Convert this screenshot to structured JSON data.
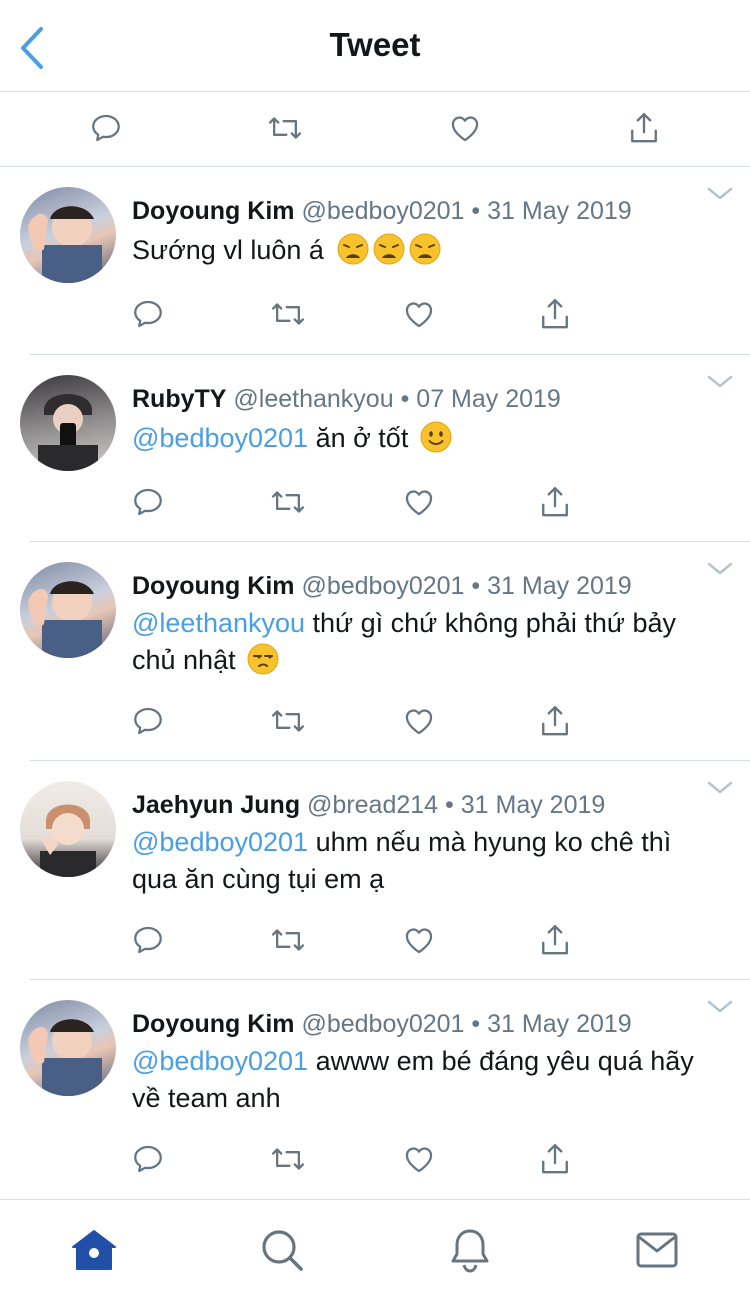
{
  "header": {
    "title": "Tweet",
    "back_icon": "chevron-left-icon"
  },
  "top_actions": [
    "reply-icon",
    "retweet-icon",
    "like-icon",
    "share-icon"
  ],
  "tweets": [
    {
      "name": "Doyoung Kim",
      "handle": "@bedboy0201",
      "dot": "•",
      "date": "31 May 2019",
      "mention": "",
      "text": "Sướng vl luôn á",
      "emoji": [
        "weary-face",
        "weary-face",
        "weary-face"
      ]
    },
    {
      "name": "RubyTY",
      "handle": "@leethankyou",
      "dot": "•",
      "date": "07 May 2019",
      "mention": "@bedboy0201",
      "text": " ăn ở tốt",
      "emoji": [
        "slightly-smiling-face"
      ]
    },
    {
      "name": "Doyoung Kim",
      "handle": "@bedboy0201",
      "dot": "•",
      "date": "31 May 2019",
      "mention": "@leethankyou",
      "text": " thứ gì chứ không phải thứ bảy chủ nhật",
      "emoji": [
        "unamused-face"
      ]
    },
    {
      "name": "Jaehyun Jung",
      "handle": "@bread214",
      "dot": "•",
      "date": "31 May 2019",
      "mention": "@bedboy0201",
      "text": " uhm nếu mà hyung ko chê thì qua ăn cùng tụi em ạ",
      "emoji": []
    },
    {
      "name": "Doyoung Kim",
      "handle": "@bedboy0201",
      "dot": "•",
      "date": "31 May 2019",
      "mention": "@bedboy0201",
      "text": " awww em bé đáng yêu quá hãy về team anh",
      "emoji": []
    }
  ],
  "tabs": [
    "home-icon",
    "search-icon",
    "notifications-icon",
    "messages-icon"
  ],
  "colors": {
    "accent": "#1da1f2",
    "mention": "#4a9ee3",
    "text": "#14171a",
    "secondary": "#657786",
    "divider": "#d7dde1",
    "icon": "#66757f",
    "home_active": "#2250a8"
  }
}
